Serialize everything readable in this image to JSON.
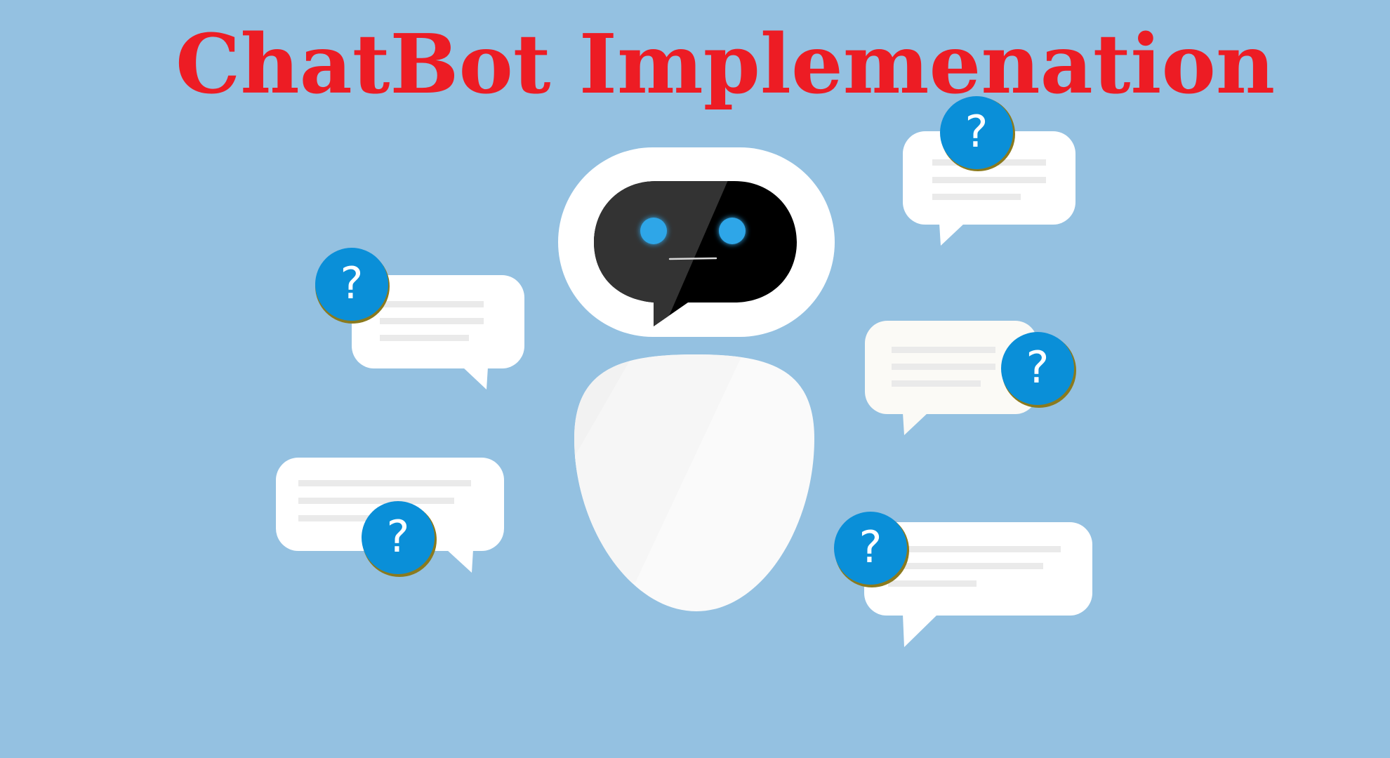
{
  "title": "ChatBot Implemenation",
  "colors": {
    "background": "#94c1e1",
    "title": "#ed1c24",
    "badge": "#0a8fd8",
    "badge_rim": "#8a7a1e",
    "bubble": "#ffffff",
    "bubble_line": "#eaeaea",
    "face_dark": "#333333",
    "face_black": "#000000",
    "robot_eye": "#2fa6e8"
  },
  "badge_symbol": "?",
  "icons": {
    "robot": "robot-icon",
    "bubble": "speech-bubble-icon",
    "question": "question-mark-icon"
  }
}
